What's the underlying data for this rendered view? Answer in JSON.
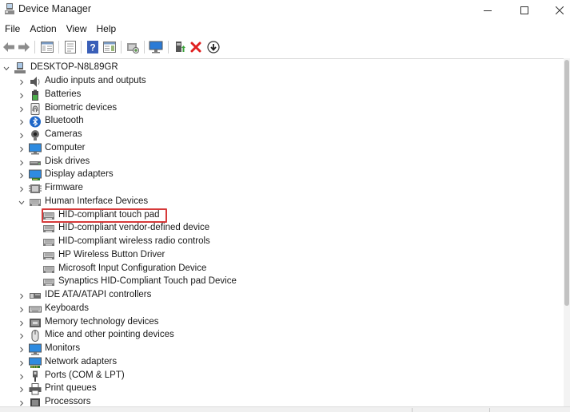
{
  "window": {
    "title": "Device Manager"
  },
  "menu": {
    "items": [
      "File",
      "Action",
      "View",
      "Help"
    ]
  },
  "toolbar": {
    "icons": [
      "back-arrow-icon",
      "forward-arrow-icon",
      "show-hide-console-tree-icon",
      "properties-icon",
      "help-icon",
      "action-pane-icon",
      "scan-hardware-icon",
      "monitor-icon",
      "update-driver-icon",
      "uninstall-icon",
      "disable-device-icon"
    ]
  },
  "tree": {
    "root": "DESKTOP-N8L89GR",
    "categories": [
      {
        "label": "Audio inputs and outputs",
        "icon": "speaker-icon"
      },
      {
        "label": "Batteries",
        "icon": "battery-icon"
      },
      {
        "label": "Biometric devices",
        "icon": "fingerprint-icon"
      },
      {
        "label": "Bluetooth",
        "icon": "bluetooth-icon"
      },
      {
        "label": "Cameras",
        "icon": "camera-icon"
      },
      {
        "label": "Computer",
        "icon": "computer-icon"
      },
      {
        "label": "Disk drives",
        "icon": "disk-drive-icon"
      },
      {
        "label": "Display adapters",
        "icon": "display-adapter-icon"
      },
      {
        "label": "Firmware",
        "icon": "firmware-icon"
      },
      {
        "label": "Human Interface Devices",
        "icon": "hid-icon",
        "expanded": true
      },
      {
        "label": "IDE ATA/ATAPI controllers",
        "icon": "ide-controller-icon"
      },
      {
        "label": "Keyboards",
        "icon": "keyboard-icon"
      },
      {
        "label": "Memory technology devices",
        "icon": "memory-icon"
      },
      {
        "label": "Mice and other pointing devices",
        "icon": "mouse-icon"
      },
      {
        "label": "Monitors",
        "icon": "monitor-icon"
      },
      {
        "label": "Network adapters",
        "icon": "network-adapter-icon"
      },
      {
        "label": "Ports (COM & LPT)",
        "icon": "port-icon"
      },
      {
        "label": "Print queues",
        "icon": "printer-icon"
      },
      {
        "label": "Processors",
        "icon": "processor-icon"
      }
    ],
    "hid_children": [
      "HID-compliant touch pad",
      "HID-compliant vendor-defined device",
      "HID-compliant wireless radio controls",
      "HP Wireless Button Driver",
      "Microsoft Input Configuration Device",
      "Synaptics HID-Compliant Touch pad Device"
    ],
    "highlighted": "HID-compliant touch pad"
  },
  "colors": {
    "highlight_border": "#d63a3a",
    "uninstall_red": "#e02020",
    "scrollbar_thumb": "#c2c2c2"
  }
}
